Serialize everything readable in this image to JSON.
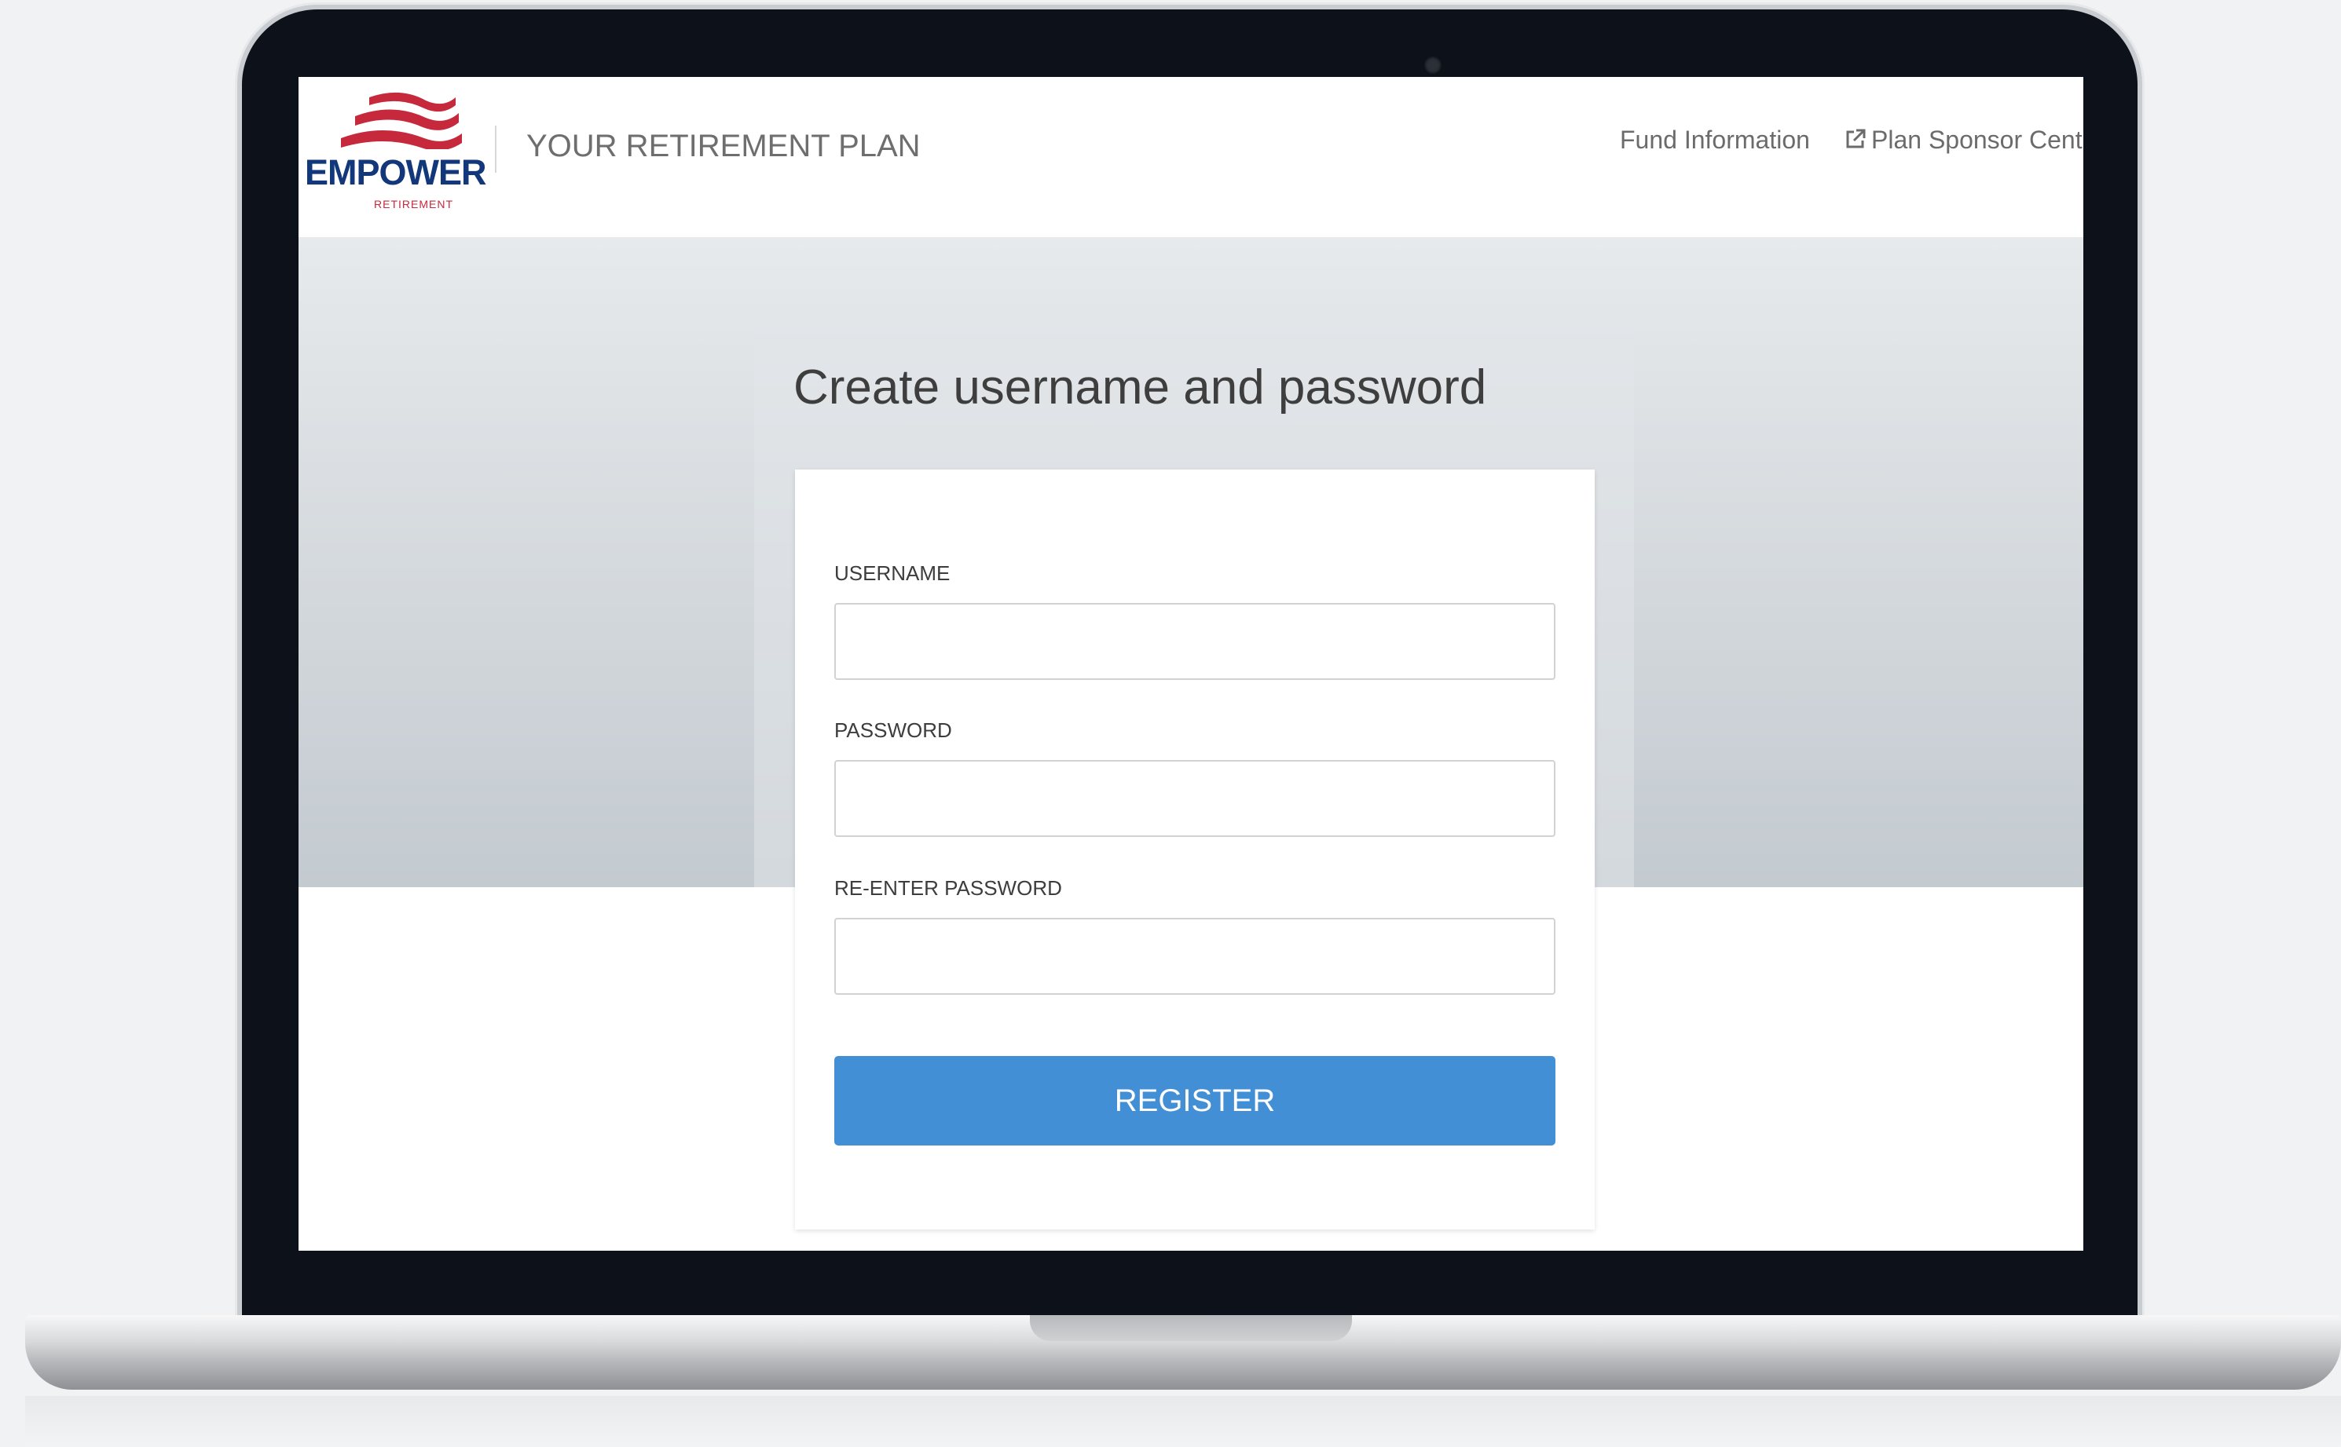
{
  "brand": {
    "logo_word": "EMPOWER",
    "logo_sub": "RETIREMENT",
    "plan_title": "YOUR RETIREMENT PLAN",
    "colors": {
      "navy": "#12377a",
      "red": "#c6283c",
      "accent_blue": "#438fd6"
    }
  },
  "nav": {
    "fund_info": "Fund Information",
    "plan_sponsor": "Plan Sponsor Center",
    "plan_sponsor_icon": "external-link-icon"
  },
  "form": {
    "title": "Create username and password",
    "username_label": "USERNAME",
    "username_value": "",
    "password_label": "PASSWORD",
    "password_value": "",
    "reenter_label": "RE-ENTER PASSWORD",
    "reenter_value": "",
    "register_label": "REGISTER"
  }
}
